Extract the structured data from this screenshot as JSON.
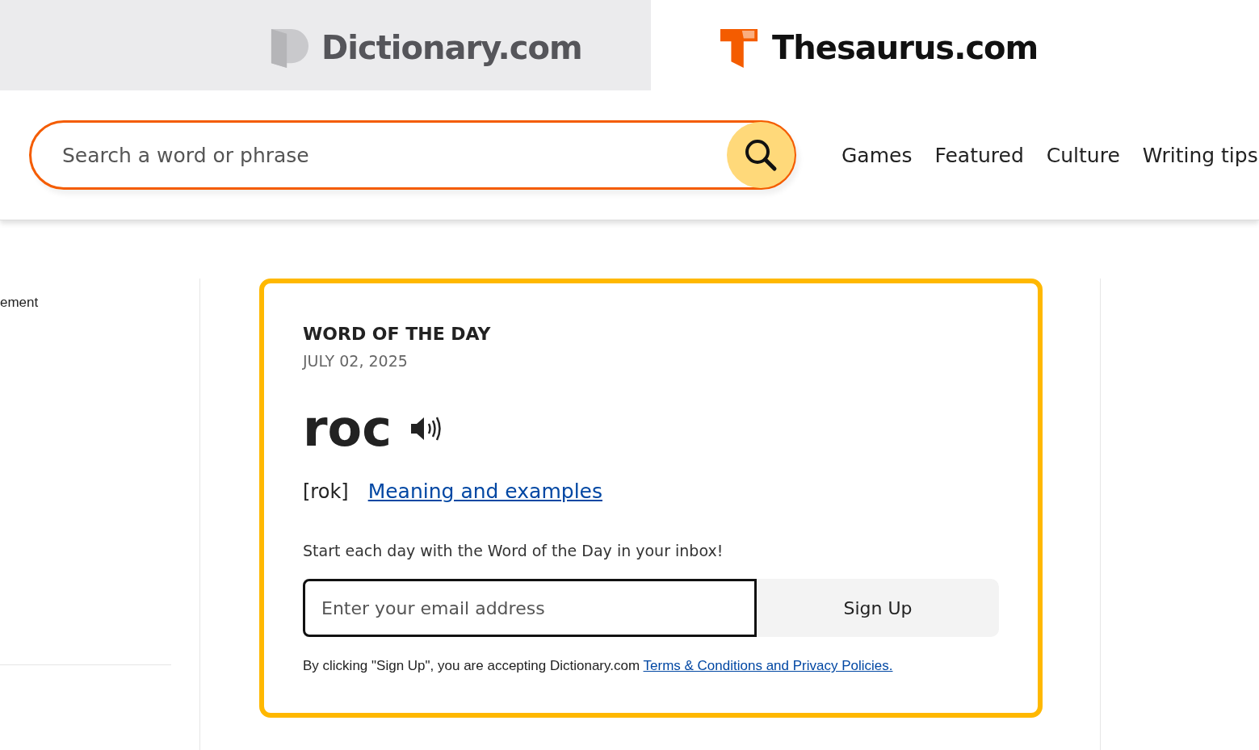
{
  "site_tabs": [
    {
      "label": "Dictionary.com",
      "selected": false,
      "kind": "dictionary"
    },
    {
      "label": "Thesaurus.com",
      "selected": true,
      "kind": "thesaurus"
    }
  ],
  "search": {
    "placeholder": "Search a word or phrase"
  },
  "nav": [
    "Games",
    "Featured",
    "Culture",
    "Writing tips"
  ],
  "sidebar": {
    "text": "ement"
  },
  "word_of_the_day": {
    "heading": "WORD OF THE DAY",
    "date": "JULY 02, 2025",
    "word": "roc",
    "pronunciation": "[rok]",
    "link": "Meaning and examples",
    "promo": "Start each day with the Word of the Day in your inbox!",
    "email_placeholder": "Enter your email address",
    "button": "Sign Up",
    "legal": "By clicking \"Sign Up\", you are accepting Dictionary.com",
    "legal_link": "Terms & Conditions and Privacy Policies."
  }
}
